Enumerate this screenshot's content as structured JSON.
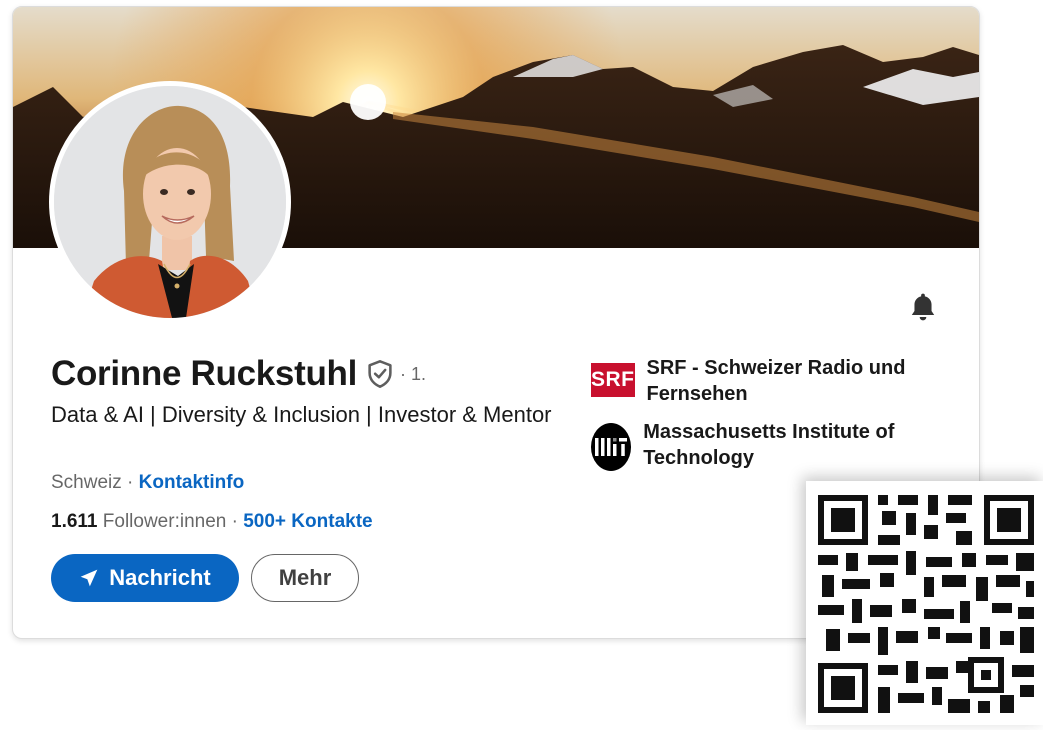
{
  "profile": {
    "name": "Corinne Ruckstuhl",
    "degree": "· 1.",
    "headline": "Data & AI | Diversity & Inclusion | Investor & Mentor",
    "location": "Schweiz",
    "location_separator": " · ",
    "contact_info_label": "Kontaktinfo",
    "followers_count": "1.611",
    "followers_label": " Follower:innen",
    "connections_separator": " · ",
    "connections_label": "500+ Kontakte"
  },
  "actions": {
    "message_label": "Nachricht",
    "more_label": "Mehr"
  },
  "organizations": [
    {
      "logo_text": "SRF",
      "name": "SRF - Schweizer Radio und Fernsehen",
      "logo_color": "#c8102e"
    },
    {
      "logo_text": "MIT",
      "name": "Massachusetts Institute of Technology",
      "logo_color": "#000000"
    }
  ],
  "icons": {
    "bell": "bell-icon",
    "verified": "shield-check-icon",
    "message": "paper-plane-icon"
  },
  "colors": {
    "accent": "#0a66c2",
    "text": "#191919",
    "muted": "#666666"
  }
}
